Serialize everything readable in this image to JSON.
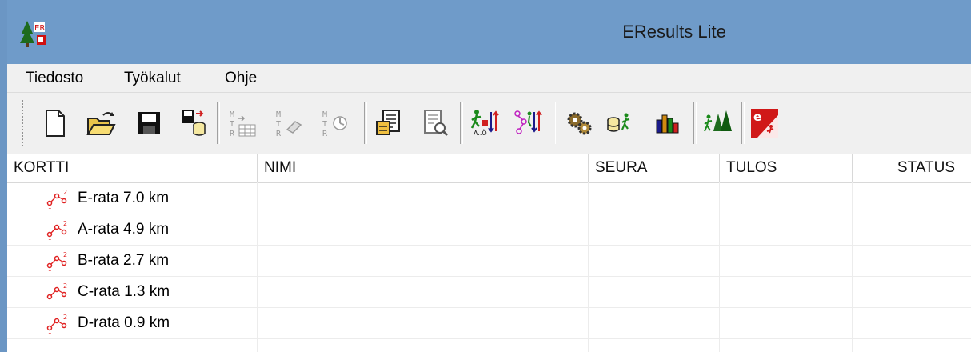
{
  "window": {
    "title": "EResults Lite"
  },
  "menu": [
    "Tiedosto",
    "Työkalut",
    "Ohje"
  ],
  "toolbar": {
    "buttons": [
      "new-file-icon",
      "open-folder-icon",
      "save-icon",
      "save-to-db-icon",
      "mtr-table-icon",
      "mtr-erase-icon",
      "mtr-clock-icon",
      "report-icon",
      "print-preview-icon",
      "sort-runners-alpha-icon",
      "sort-course-icon",
      "settings-gears-icon",
      "db-runner-icon",
      "bar-chart-icon",
      "trees-runner-icon",
      "eresults-logo-icon"
    ]
  },
  "table": {
    "columns": [
      "KORTTI",
      "NIMI",
      "SEURA",
      "TULOS",
      "STATUS"
    ],
    "rows": [
      {
        "kortti": "E-rata 7.0 km",
        "nimi": "",
        "seura": "",
        "tulos": "",
        "status": ""
      },
      {
        "kortti": "A-rata 4.9 km",
        "nimi": "",
        "seura": "",
        "tulos": "",
        "status": ""
      },
      {
        "kortti": "B-rata 2.7 km",
        "nimi": "",
        "seura": "",
        "tulos": "",
        "status": ""
      },
      {
        "kortti": "C-rata 1.3 km",
        "nimi": "",
        "seura": "",
        "tulos": "",
        "status": ""
      },
      {
        "kortti": "D-rata 0.9 km",
        "nimi": "",
        "seura": "",
        "tulos": "",
        "status": ""
      }
    ]
  },
  "colors": {
    "titlebar": "#6f9bc9",
    "chrome": "#f0f0f0",
    "course_icon": "#e02020"
  }
}
